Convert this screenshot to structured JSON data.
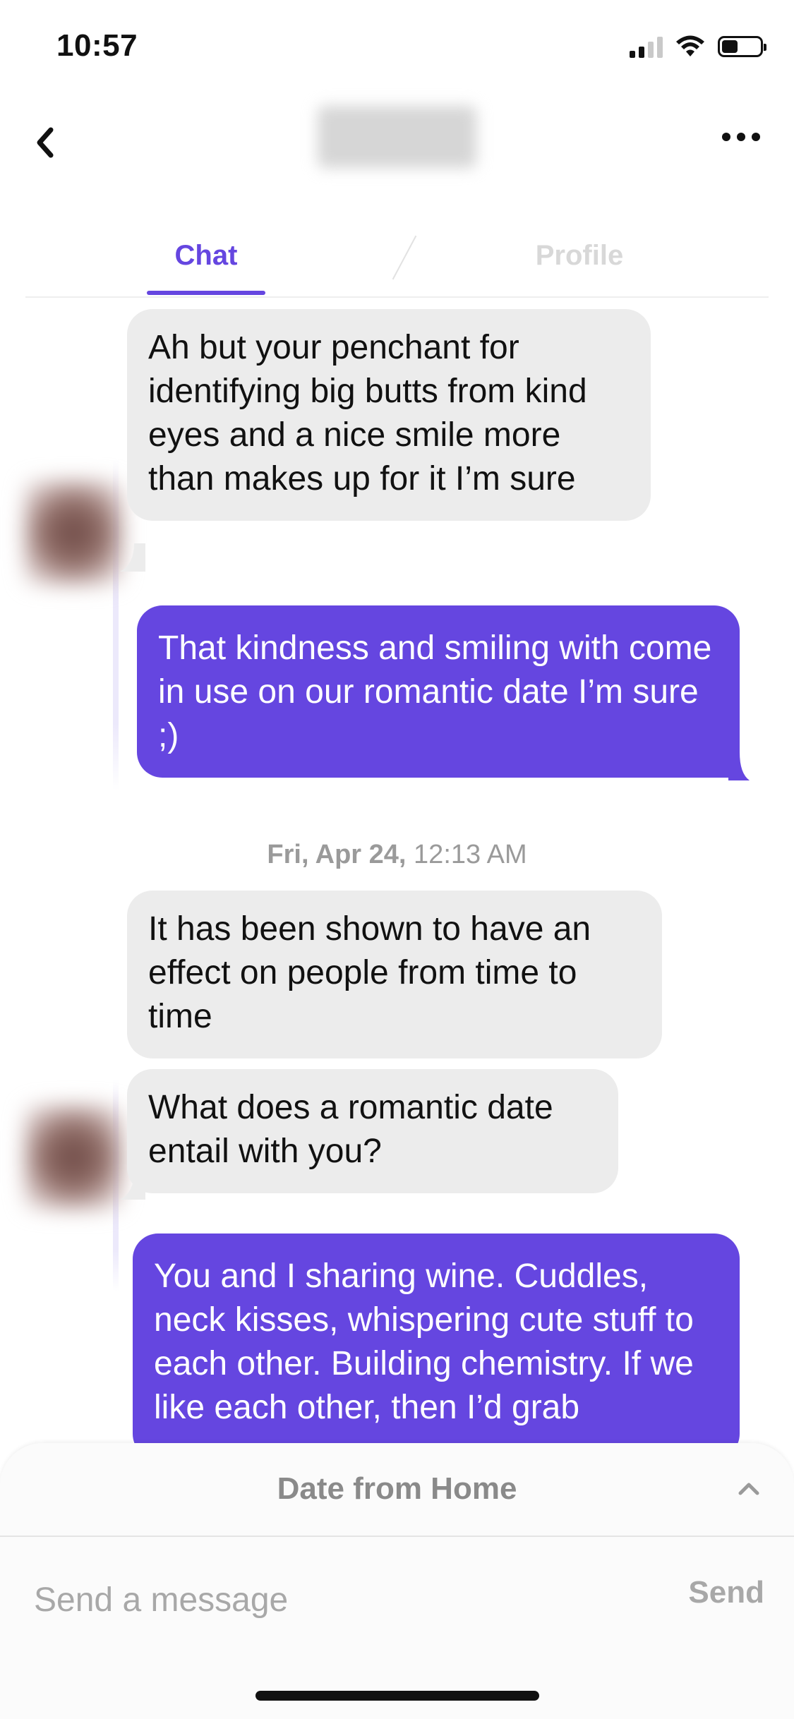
{
  "status_bar": {
    "time": "10:57"
  },
  "header": {
    "back_icon": "chevron-left-icon",
    "more_icon": "ellipsis-icon"
  },
  "tabs": [
    {
      "label": "Chat",
      "active": true
    },
    {
      "label": "Profile",
      "active": false
    }
  ],
  "messages": [
    {
      "direction": "in",
      "text": "Ah but your penchant for identifying big butts from kind eyes and a nice smile more than makes up for it I’m sure"
    },
    {
      "direction": "out",
      "text": "That kindness and smiling with come in use on our romantic date I’m sure ;)"
    },
    {
      "direction": "in",
      "text": "It has been shown to have an effect on people from time to time"
    },
    {
      "direction": "in",
      "text": "What does a romantic date entail with you?"
    },
    {
      "direction": "out",
      "text": "You and I sharing wine. Cuddles, neck kisses, whispering cute stuff to each other. Building chemistry. If we like each other, then I’d grab"
    }
  ],
  "timestamp": {
    "day": "Fri, Apr 24,",
    "time": "12:13 AM"
  },
  "date_from_home": {
    "title": "Date from Home"
  },
  "composer": {
    "placeholder": "Send a message",
    "send_label": "Send"
  },
  "colors": {
    "accent": "#6546e0",
    "incoming_bubble": "#ececec",
    "muted_text": "#a8a8a8"
  }
}
